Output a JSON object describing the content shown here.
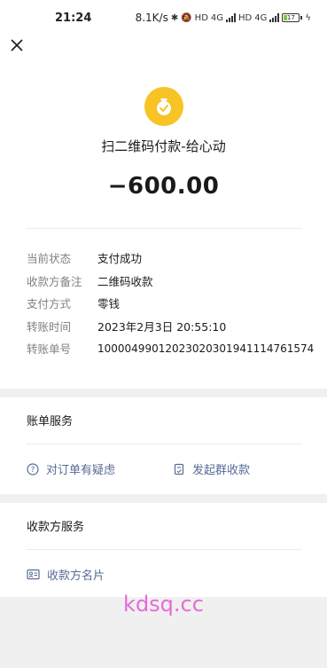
{
  "status_bar": {
    "time": "21:24",
    "speed": "8.1K/s",
    "sim1_type": "4G",
    "sim2_type": "4G",
    "battery": "17"
  },
  "hero": {
    "title": "扫二维码付款-给心动",
    "amount": "−600.00",
    "icon": "coin-bag-icon",
    "icon_color": "#f7c325"
  },
  "details": [
    {
      "key": "当前状态",
      "value": "支付成功"
    },
    {
      "key": "收款方备注",
      "value": "二维码收款"
    },
    {
      "key": "支付方式",
      "value": "零钱"
    },
    {
      "key": "转账时间",
      "value": "2023年2月3日 20:55:10"
    },
    {
      "key": "转账单号",
      "value": "10000499012023020301941114761574"
    }
  ],
  "bill_services": {
    "title": "账单服务",
    "query_label": "对订单有疑虑",
    "group_label": "发起群收款"
  },
  "payee_services": {
    "title": "收款方服务",
    "card_label": "收款方名片"
  },
  "watermark": "kdsq.cc",
  "link_color": "#576b95"
}
